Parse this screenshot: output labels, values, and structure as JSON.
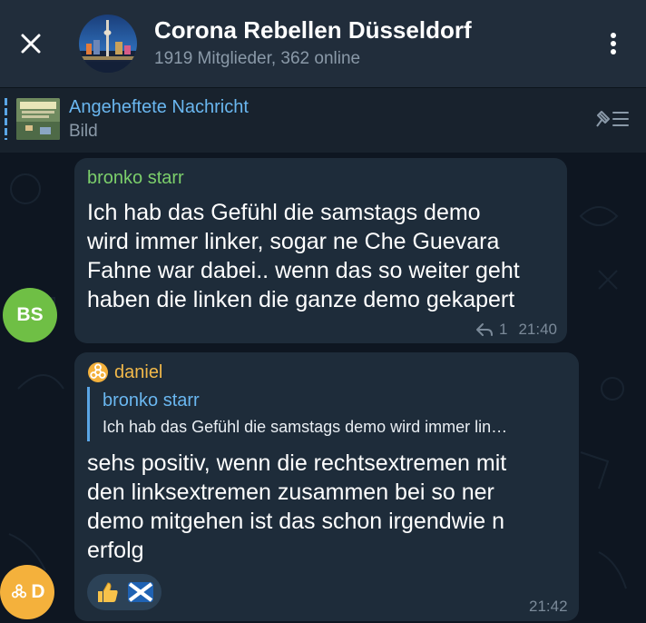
{
  "header": {
    "title": "Corona Rebellen Düsseldorf",
    "subtitle": "1919 Mitglieder, 362 online"
  },
  "pinned": {
    "title": "Angeheftete Nachricht",
    "subtitle": "Bild"
  },
  "messages": [
    {
      "sender": "bronko starr",
      "text": "Ich hab das Gefühl die samstags demo wird immer linker, sogar ne Che Guevara Fahne war dabei.. wenn das so weiter geht haben die linken die ganze demo gekapert",
      "lines": [
        "Ich hab das Gefühl die samstags demo",
        "wird immer linker, sogar ne Che Guevara",
        "Fahne war dabei.. wenn das so weiter geht",
        "haben die linken die ganze demo gekapert"
      ],
      "reply_count": "1",
      "time": "21:40",
      "avatar_initials": "BS"
    },
    {
      "sender": "daniel",
      "reply_to_name": "bronko starr",
      "reply_to_text": "Ich hab das Gefühl die samstags demo wird immer lin…",
      "lines": [
        "sehs positiv, wenn die rechtsextremen mit",
        "den linksextremen zusammen bei so ner",
        "demo mitgehen ist das schon irgendwie n",
        "erfolg"
      ],
      "time": "21:42",
      "avatar_initials": "D",
      "reactions": [
        "thumbs-up",
        "scotland-flag"
      ]
    }
  ],
  "colors": {
    "header_bg": "#212d3b",
    "chat_bg": "#0e1621",
    "bubble_bg": "#1e2c3a",
    "accent_blue": "#6ab7f0",
    "sender_green": "#7ccf6b",
    "sender_orange": "#f2b94a",
    "avatar_green": "#6fbf45",
    "avatar_orange": "#f4b13c"
  }
}
